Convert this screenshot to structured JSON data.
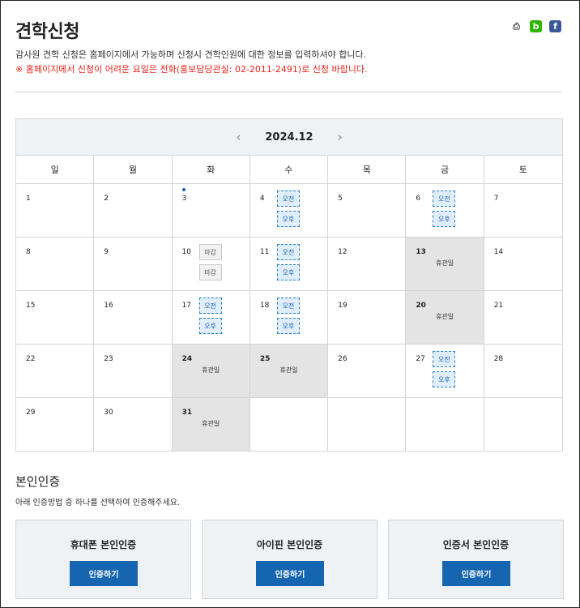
{
  "page": {
    "title": "견학신청",
    "description": "감사원 견학 신청은 홈페이지에서 가능하며 신청시 견학인원에 대한 정보를 입력하셔야 합니다.",
    "notice": "※ 홈페이지에서 신청이 어려운 요일은 전화(홍보담당관실: 02-2011-2491)로 신청 바랍니다."
  },
  "icons": {
    "print": "print-icon",
    "blog": "blog-icon",
    "facebook": "facebook-icon"
  },
  "colors": {
    "accent": "#1565b0",
    "notice": "#e2231a",
    "slot_border": "#2a7fcb",
    "closed_bg": "#e4e4e4"
  },
  "calendar": {
    "month_label": "2024.12",
    "prev_label": "‹",
    "next_label": "›",
    "weekdays": [
      "일",
      "월",
      "화",
      "수",
      "목",
      "금",
      "토"
    ],
    "weeks": [
      [
        {
          "day": "1"
        },
        {
          "day": "2"
        },
        {
          "day": "3",
          "dot": true
        },
        {
          "day": "4",
          "slots": [
            "오전",
            "오후"
          ]
        },
        {
          "day": "5"
        },
        {
          "day": "6",
          "slots": [
            "오전",
            "오후"
          ]
        },
        {
          "day": "7"
        }
      ],
      [
        {
          "day": "8"
        },
        {
          "day": "9"
        },
        {
          "day": "10",
          "closed_slots": [
            "마감",
            "마감"
          ]
        },
        {
          "day": "11",
          "slots": [
            "오전",
            "오후"
          ]
        },
        {
          "day": "12"
        },
        {
          "day": "13",
          "holiday": "휴관일"
        },
        {
          "day": "14"
        }
      ],
      [
        {
          "day": "15"
        },
        {
          "day": "16"
        },
        {
          "day": "17",
          "slots": [
            "오전",
            "오후"
          ]
        },
        {
          "day": "18",
          "slots": [
            "오전",
            "오후"
          ]
        },
        {
          "day": "19"
        },
        {
          "day": "20",
          "holiday": "휴관일"
        },
        {
          "day": "21"
        }
      ],
      [
        {
          "day": "22"
        },
        {
          "day": "23"
        },
        {
          "day": "24",
          "holiday": "휴관일"
        },
        {
          "day": "25",
          "holiday": "휴관일"
        },
        {
          "day": "26"
        },
        {
          "day": "27",
          "slots": [
            "오전",
            "오후"
          ]
        },
        {
          "day": "28"
        }
      ],
      [
        {
          "day": "29"
        },
        {
          "day": "30"
        },
        {
          "day": "31",
          "holiday": "휴관일"
        },
        {
          "day": ""
        },
        {
          "day": ""
        },
        {
          "day": ""
        },
        {
          "day": ""
        }
      ]
    ]
  },
  "auth": {
    "title": "본인인증",
    "description": "아래 인증방법 중 하나를 선택하여 인증해주세요.",
    "options": [
      {
        "title": "휴대폰 본인인증",
        "button": "인증하기"
      },
      {
        "title": "아이핀 본인인증",
        "button": "인증하기"
      },
      {
        "title": "인증서 본인인증",
        "button": "인증하기"
      }
    ]
  }
}
